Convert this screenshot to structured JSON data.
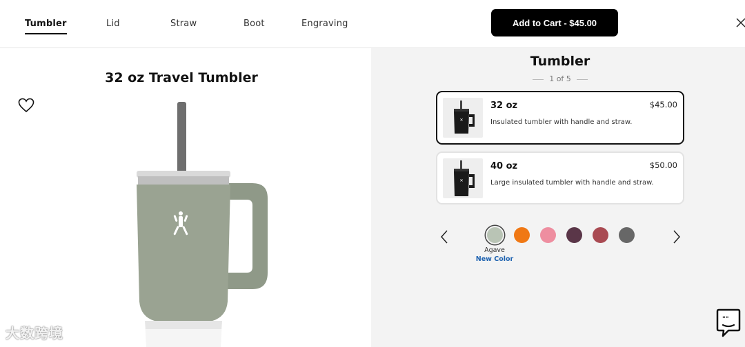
{
  "tabs": [
    {
      "label": "Tumbler",
      "active": true
    },
    {
      "label": "Lid"
    },
    {
      "label": "Straw"
    },
    {
      "label": "Boot"
    },
    {
      "label": "Engraving"
    }
  ],
  "cart_button": "Add to Cart - $45.00",
  "product": {
    "title": "32 oz Travel Tumbler",
    "color": "#9aa392"
  },
  "options_panel": {
    "title": "Tumbler",
    "step": "1 of 5",
    "sizes": [
      {
        "size": "32 oz",
        "price": "$45.00",
        "desc": "Insulated tumbler with handle and straw.",
        "selected": true
      },
      {
        "size": "40 oz",
        "price": "$50.00",
        "desc": "Large insulated tumbler with handle and straw.",
        "selected": false
      }
    ],
    "swatches": [
      {
        "color": "#b9c4b5",
        "selected": true
      },
      {
        "color": "#f07814"
      },
      {
        "color": "#ee8ea0"
      },
      {
        "color": "#5a3648"
      },
      {
        "color": "#a94a52"
      },
      {
        "color": "#676767"
      }
    ],
    "selected_color_name": "Agave",
    "selected_color_badge": "New Color"
  },
  "watermark": "大数跨境"
}
